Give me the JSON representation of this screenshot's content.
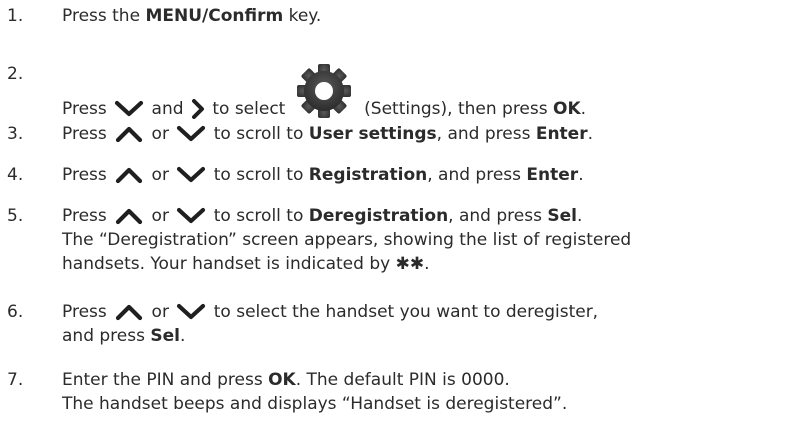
{
  "steps": [
    {
      "num": "1.",
      "parts": {
        "a": "Press the ",
        "b": "MENU/Confirm",
        "c": " key."
      }
    },
    {
      "num": "2.",
      "parts": {
        "a": "Press ",
        "b": " and ",
        "c": " to select ",
        "d": " (Settings), then press ",
        "e": "OK",
        "f": "."
      }
    },
    {
      "num": "3.",
      "parts": {
        "a": "Press ",
        "b": " or ",
        "c": " to scroll to ",
        "d": "User settings",
        "e": ", and press ",
        "f": "Enter",
        "g": "."
      }
    },
    {
      "num": "4.",
      "parts": {
        "a": "Press ",
        "b": " or ",
        "c": "  to scroll to ",
        "d": "Registration",
        "e": ", and press ",
        "f": "Enter",
        "g": "."
      }
    },
    {
      "num": "5.",
      "parts": {
        "a": "Press ",
        "b": " or ",
        "c": "  to scroll to ",
        "d": "Deregistration",
        "e": ", and press ",
        "f": "Sel",
        "g": ".",
        "line2": "The “Deregistration” screen appears, showing the list of registered",
        "line3": "handsets. Your handset is indicated by ✱✱."
      }
    },
    {
      "num": "6.",
      "parts": {
        "a": "Press ",
        "b": " or ",
        "c": "  to select the handset you want to deregister,",
        "line2a": "and press ",
        "line2b": "Sel",
        "line2c": "."
      }
    },
    {
      "num": "7.",
      "parts": {
        "a": "Enter the PIN and press ",
        "b": "OK",
        "c": ". The default PIN is 0000.",
        "line2": "The handset beeps and displays “Handset is deregistered”."
      }
    }
  ],
  "icons": {
    "down": "chevron-down-icon",
    "up": "chevron-up-icon",
    "right": "chevron-right-icon",
    "settings": "gear-icon"
  },
  "colors": {
    "text": "#2b2b2b",
    "icon": "#1f1f1f",
    "gear": "#3a3a3a"
  }
}
